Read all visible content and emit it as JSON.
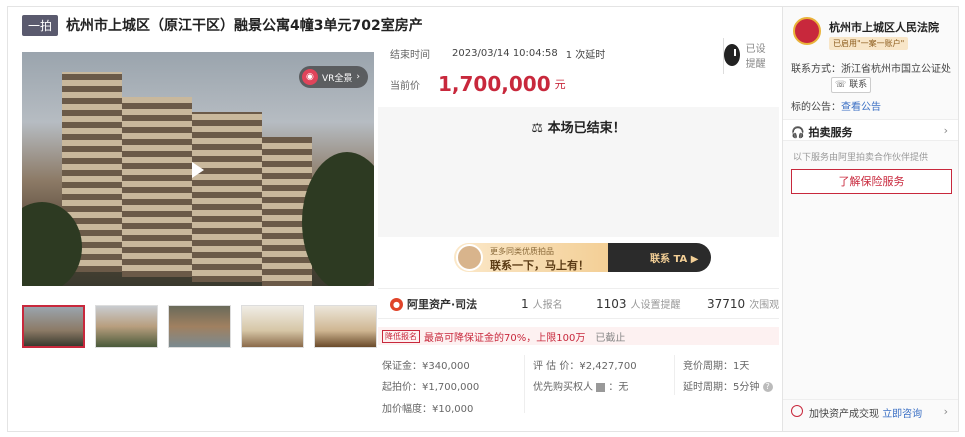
{
  "header": {
    "tag": "一拍",
    "title": "杭州市上城区（原江干区）融景公寓4幢3单元702室房产"
  },
  "media": {
    "vr_label": "VR全景"
  },
  "auction": {
    "end_label": "结束时间",
    "end_time": "2023/03/14 10:04:58",
    "delay": "1 次延时",
    "price_label": "当前价",
    "price": "1,700,000",
    "price_unit": "元",
    "remind_label": "已设提醒",
    "ended_text": "本场已结束！"
  },
  "banner": {
    "line1": "更多同类优质拍品",
    "line2": "联系一下，马上有！",
    "cta": "联系 TA"
  },
  "stats": {
    "brand": "阿里资产·司法",
    "signup_count": "1",
    "signup_label": "人报名",
    "remind_count": "1103",
    "remind_label": "人设置提醒",
    "view_count": "37710",
    "view_label": "次围观"
  },
  "discount": {
    "tag": "降低报名",
    "text": "最高可降保证金的70%，上限100万",
    "status": "已截止"
  },
  "details": {
    "deposit": "保证金：¥340,000",
    "appraisal": "评 估 价：¥2,427,700",
    "period": "竞价周期：1天",
    "start": "起拍价：¥1,700,000",
    "priority": "优先购买权人",
    "priority_value": "：无",
    "delay_period": "延时周期：5分钟",
    "increment": "加价幅度：¥10,000"
  },
  "court": {
    "name": "杭州市上城区人民法院",
    "badge": "已启用\"一案一账户\"",
    "contact_label": "联系方式：",
    "contact_value": "浙江省杭州市国立公证处",
    "contact_btn": "联系",
    "notice_label": "标的公告：",
    "notice_link": "查看公告"
  },
  "service": {
    "title": "拍卖服务",
    "note": "以下服务由阿里拍卖合作伙伴提供",
    "button": "了解保险服务"
  },
  "bottom": {
    "text": "加快资产成交现",
    "link": "立即咨询"
  },
  "colors": {
    "accent": "#c8283c",
    "link": "#3a6fc4"
  }
}
